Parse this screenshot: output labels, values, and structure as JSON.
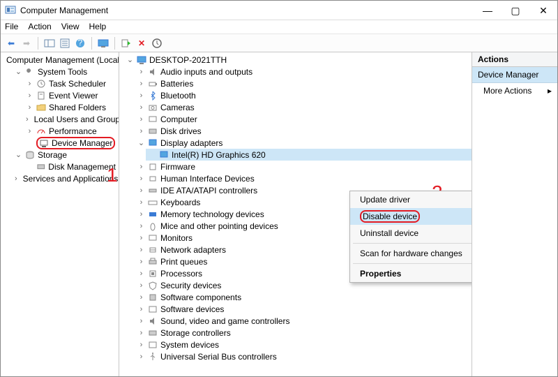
{
  "window": {
    "title": "Computer Management"
  },
  "menus": {
    "file": "File",
    "action": "Action",
    "view": "View",
    "help": "Help"
  },
  "left": {
    "root": "Computer Management (Local",
    "system_tools": "System Tools",
    "task_sched": "Task Scheduler",
    "event_viewer": "Event Viewer",
    "shared_folders": "Shared Folders",
    "local_users": "Local Users and Groups",
    "performance": "Performance",
    "device_manager": "Device Manager",
    "storage": "Storage",
    "disk_mgmt": "Disk Management",
    "services_apps": "Services and Applications"
  },
  "mid": {
    "root": "DESKTOP-2021TTH",
    "items": {
      "audio": "Audio inputs and outputs",
      "batteries": "Batteries",
      "bluetooth": "Bluetooth",
      "cameras": "Cameras",
      "computer": "Computer",
      "disk": "Disk drives",
      "display": "Display adapters",
      "display_child": "Intel(R) HD Graphics 620",
      "firmware": "Firmware",
      "hid": "Human Interface Devices",
      "ide": "IDE ATA/ATAPI controllers",
      "keyboards": "Keyboards",
      "memtech": "Memory technology devices",
      "mice": "Mice and other pointing devices",
      "monitors": "Monitors",
      "network": "Network adapters",
      "printq": "Print queues",
      "processors": "Processors",
      "security": "Security devices",
      "softcomp": "Software components",
      "softdev": "Software devices",
      "sound": "Sound, video and game controllers",
      "storctrl": "Storage controllers",
      "sysdev": "System devices",
      "usb": "Universal Serial Bus controllers"
    }
  },
  "ctx": {
    "update": "Update driver",
    "disable": "Disable device",
    "uninstall": "Uninstall device",
    "scan": "Scan for hardware changes",
    "props": "Properties"
  },
  "actions": {
    "hdr": "Actions",
    "sel": "Device Manager",
    "more": "More Actions"
  },
  "anno": {
    "one": "1",
    "two": "2"
  }
}
